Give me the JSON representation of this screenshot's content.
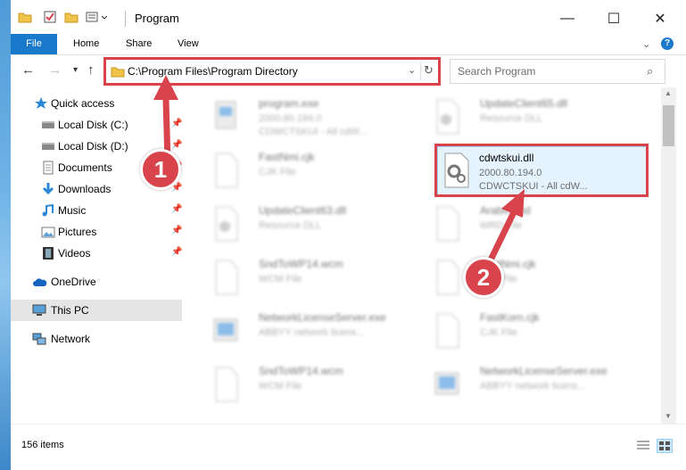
{
  "window": {
    "title": "Program",
    "controls": {
      "minimize": "—",
      "maximize": "☐",
      "close": "✕"
    }
  },
  "ribbon": {
    "tabs": [
      {
        "label": "File"
      },
      {
        "label": "Home"
      },
      {
        "label": "Share"
      },
      {
        "label": "View"
      }
    ]
  },
  "address": {
    "path": "C:\\Program Files\\Program Directory"
  },
  "search": {
    "placeholder": "Search Program"
  },
  "sidebar": {
    "items": [
      {
        "label": "Quick access",
        "icon": "star-icon"
      },
      {
        "label": "Local Disk (C:)",
        "icon": "drive-icon"
      },
      {
        "label": "Local Disk (D:)",
        "icon": "drive-icon"
      },
      {
        "label": "Documents",
        "icon": "documents-icon"
      },
      {
        "label": "Downloads",
        "icon": "download-icon"
      },
      {
        "label": "Music",
        "icon": "music-icon"
      },
      {
        "label": "Pictures",
        "icon": "pictures-icon"
      },
      {
        "label": "Videos",
        "icon": "videos-icon"
      },
      {
        "label": "OneDrive",
        "icon": "cloud-icon"
      },
      {
        "label": "This PC",
        "icon": "computer-icon"
      },
      {
        "label": "Network",
        "icon": "network-icon"
      }
    ]
  },
  "files": [
    {
      "name": "program.exe",
      "line1": "2000.80.194.0",
      "line2": "CDWCTSKUI - All cdW..."
    },
    {
      "name": "UpdateClient65.dll",
      "line1": "Resource DLL",
      "line2": ""
    },
    {
      "name": "FastNmi.cjk",
      "line1": "CJK File",
      "line2": ""
    },
    {
      "name": "cdwtskui.dll",
      "line1": "2000.80.194.0",
      "line2": "CDWCTSKUI - All cdW..."
    },
    {
      "name": "UpdateClient63.dll",
      "line1": "Resource DLL",
      "line2": ""
    },
    {
      "name": "ArabicGrid",
      "line1": "WRD File",
      "line2": ""
    },
    {
      "name": "SndToWP14.wcm",
      "line1": "WCM File",
      "line2": ""
    },
    {
      "name": "FastNmi.cjk",
      "line1": "CJK File",
      "line2": ""
    },
    {
      "name": "NetworkLicenseServer.exe",
      "line1": "ABBYY network licens...",
      "line2": ""
    },
    {
      "name": "FastKorn.cjk",
      "line1": "CJK File",
      "line2": ""
    },
    {
      "name": "SndToWP14.wcm",
      "line1": "WCM File",
      "line2": ""
    },
    {
      "name": "NetworkLicenseServer.exe",
      "line1": "ABBYY network licens...",
      "line2": ""
    }
  ],
  "status": {
    "count": "156 items"
  },
  "callouts": {
    "step1": "1",
    "step2": "2"
  },
  "colors": {
    "accent": "#1979ca",
    "highlight": "#d9434b"
  }
}
